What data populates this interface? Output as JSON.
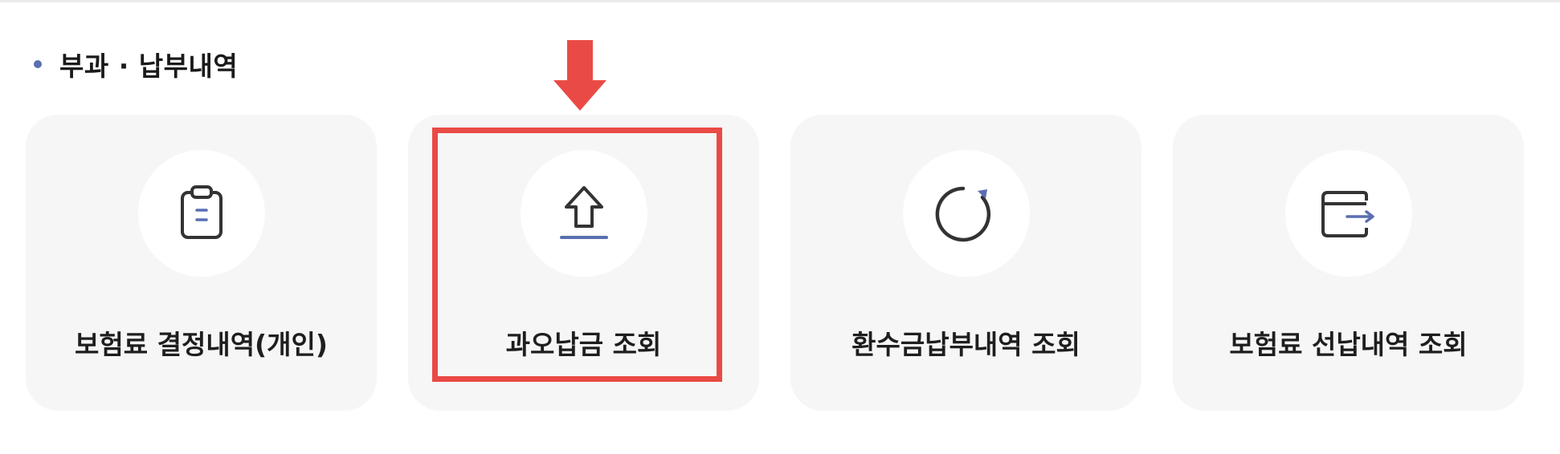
{
  "section": {
    "title": "부과 · 납부내역"
  },
  "cards": [
    {
      "label": "보험료 결정내역(개인)",
      "icon": "clipboard-icon"
    },
    {
      "label": "과오납금 조회",
      "icon": "upload-arrow-icon"
    },
    {
      "label": "환수금납부내역 조회",
      "icon": "refresh-icon"
    },
    {
      "label": "보험료 선납내역 조회",
      "icon": "wallet-icon"
    }
  ],
  "annotation": {
    "highlight_color": "#ea4a45",
    "highlighted_card": "과오납금 조회"
  },
  "colors": {
    "accent": "#5a6fb0",
    "card_bg": "#f6f6f6",
    "icon_stroke": "#333333"
  }
}
